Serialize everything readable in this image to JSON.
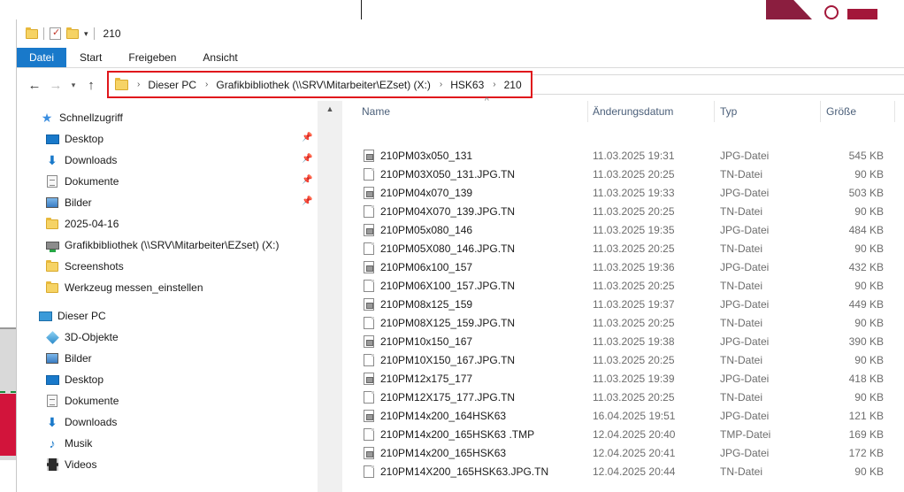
{
  "window_title": "210",
  "ribbon_tabs": [
    "Datei",
    "Start",
    "Freigeben",
    "Ansicht"
  ],
  "breadcrumb": [
    "Dieser PC",
    "Grafikbibliothek (\\\\SRV\\Mitarbeiter\\EZset) (X:)",
    "HSK63",
    "210"
  ],
  "nav": {
    "quick_access": "Schnellzugriff",
    "quick_items": [
      {
        "label": "Desktop",
        "icon": "desktop-icon",
        "pinned": true
      },
      {
        "label": "Downloads",
        "icon": "downloads-icon",
        "pinned": true
      },
      {
        "label": "Dokumente",
        "icon": "documents-icon",
        "pinned": true
      },
      {
        "label": "Bilder",
        "icon": "pictures-icon",
        "pinned": true
      },
      {
        "label": "2025-04-16",
        "icon": "folder-icon",
        "pinned": false
      },
      {
        "label": "Grafikbibliothek (\\\\SRV\\Mitarbeiter\\EZset) (X:)",
        "icon": "network-drive-icon",
        "pinned": false
      },
      {
        "label": "Screenshots",
        "icon": "folder-icon",
        "pinned": false
      },
      {
        "label": "Werkzeug messen_einstellen",
        "icon": "folder-icon",
        "pinned": false
      }
    ],
    "this_pc": "Dieser PC",
    "pc_items": [
      {
        "label": "3D-Objekte",
        "icon": "3d-objects-icon"
      },
      {
        "label": "Bilder",
        "icon": "pictures-icon"
      },
      {
        "label": "Desktop",
        "icon": "desktop-icon"
      },
      {
        "label": "Dokumente",
        "icon": "documents-icon"
      },
      {
        "label": "Downloads",
        "icon": "downloads-icon"
      },
      {
        "label": "Musik",
        "icon": "music-icon"
      },
      {
        "label": "Videos",
        "icon": "videos-icon"
      }
    ]
  },
  "columns": {
    "name": "Name",
    "date": "Änderungsdatum",
    "type": "Typ",
    "size": "Größe"
  },
  "files": [
    {
      "name": "210PM03x050_131",
      "date": "11.03.2025 19:31",
      "type": "JPG-Datei",
      "size": "545 KB",
      "icon": "image"
    },
    {
      "name": "210PM03X050_131.JPG.TN",
      "date": "11.03.2025 20:25",
      "type": "TN-Datei",
      "size": "90 KB",
      "icon": "plain"
    },
    {
      "name": "210PM04x070_139",
      "date": "11.03.2025 19:33",
      "type": "JPG-Datei",
      "size": "503 KB",
      "icon": "image"
    },
    {
      "name": "210PM04X070_139.JPG.TN",
      "date": "11.03.2025 20:25",
      "type": "TN-Datei",
      "size": "90 KB",
      "icon": "plain"
    },
    {
      "name": "210PM05x080_146",
      "date": "11.03.2025 19:35",
      "type": "JPG-Datei",
      "size": "484 KB",
      "icon": "image"
    },
    {
      "name": "210PM05X080_146.JPG.TN",
      "date": "11.03.2025 20:25",
      "type": "TN-Datei",
      "size": "90 KB",
      "icon": "plain"
    },
    {
      "name": "210PM06x100_157",
      "date": "11.03.2025 19:36",
      "type": "JPG-Datei",
      "size": "432 KB",
      "icon": "image"
    },
    {
      "name": "210PM06X100_157.JPG.TN",
      "date": "11.03.2025 20:25",
      "type": "TN-Datei",
      "size": "90 KB",
      "icon": "plain"
    },
    {
      "name": "210PM08x125_159",
      "date": "11.03.2025 19:37",
      "type": "JPG-Datei",
      "size": "449 KB",
      "icon": "image"
    },
    {
      "name": "210PM08X125_159.JPG.TN",
      "date": "11.03.2025 20:25",
      "type": "TN-Datei",
      "size": "90 KB",
      "icon": "plain"
    },
    {
      "name": "210PM10x150_167",
      "date": "11.03.2025 19:38",
      "type": "JPG-Datei",
      "size": "390 KB",
      "icon": "image"
    },
    {
      "name": "210PM10X150_167.JPG.TN",
      "date": "11.03.2025 20:25",
      "type": "TN-Datei",
      "size": "90 KB",
      "icon": "plain"
    },
    {
      "name": "210PM12x175_177",
      "date": "11.03.2025 19:39",
      "type": "JPG-Datei",
      "size": "418 KB",
      "icon": "image"
    },
    {
      "name": "210PM12X175_177.JPG.TN",
      "date": "11.03.2025 20:25",
      "type": "TN-Datei",
      "size": "90 KB",
      "icon": "plain"
    },
    {
      "name": "210PM14x200_164HSK63",
      "date": "16.04.2025 19:51",
      "type": "JPG-Datei",
      "size": "121 KB",
      "icon": "image"
    },
    {
      "name": "210PM14x200_165HSK63 .TMP",
      "date": "12.04.2025 20:40",
      "type": "TMP-Datei",
      "size": "169 KB",
      "icon": "plain"
    },
    {
      "name": "210PM14x200_165HSK63",
      "date": "12.04.2025 20:41",
      "type": "JPG-Datei",
      "size": "172 KB",
      "icon": "image"
    },
    {
      "name": "210PM14X200_165HSK63.JPG.TN",
      "date": "12.04.2025 20:44",
      "type": "TN-Datei",
      "size": "90 KB",
      "icon": "plain"
    }
  ]
}
